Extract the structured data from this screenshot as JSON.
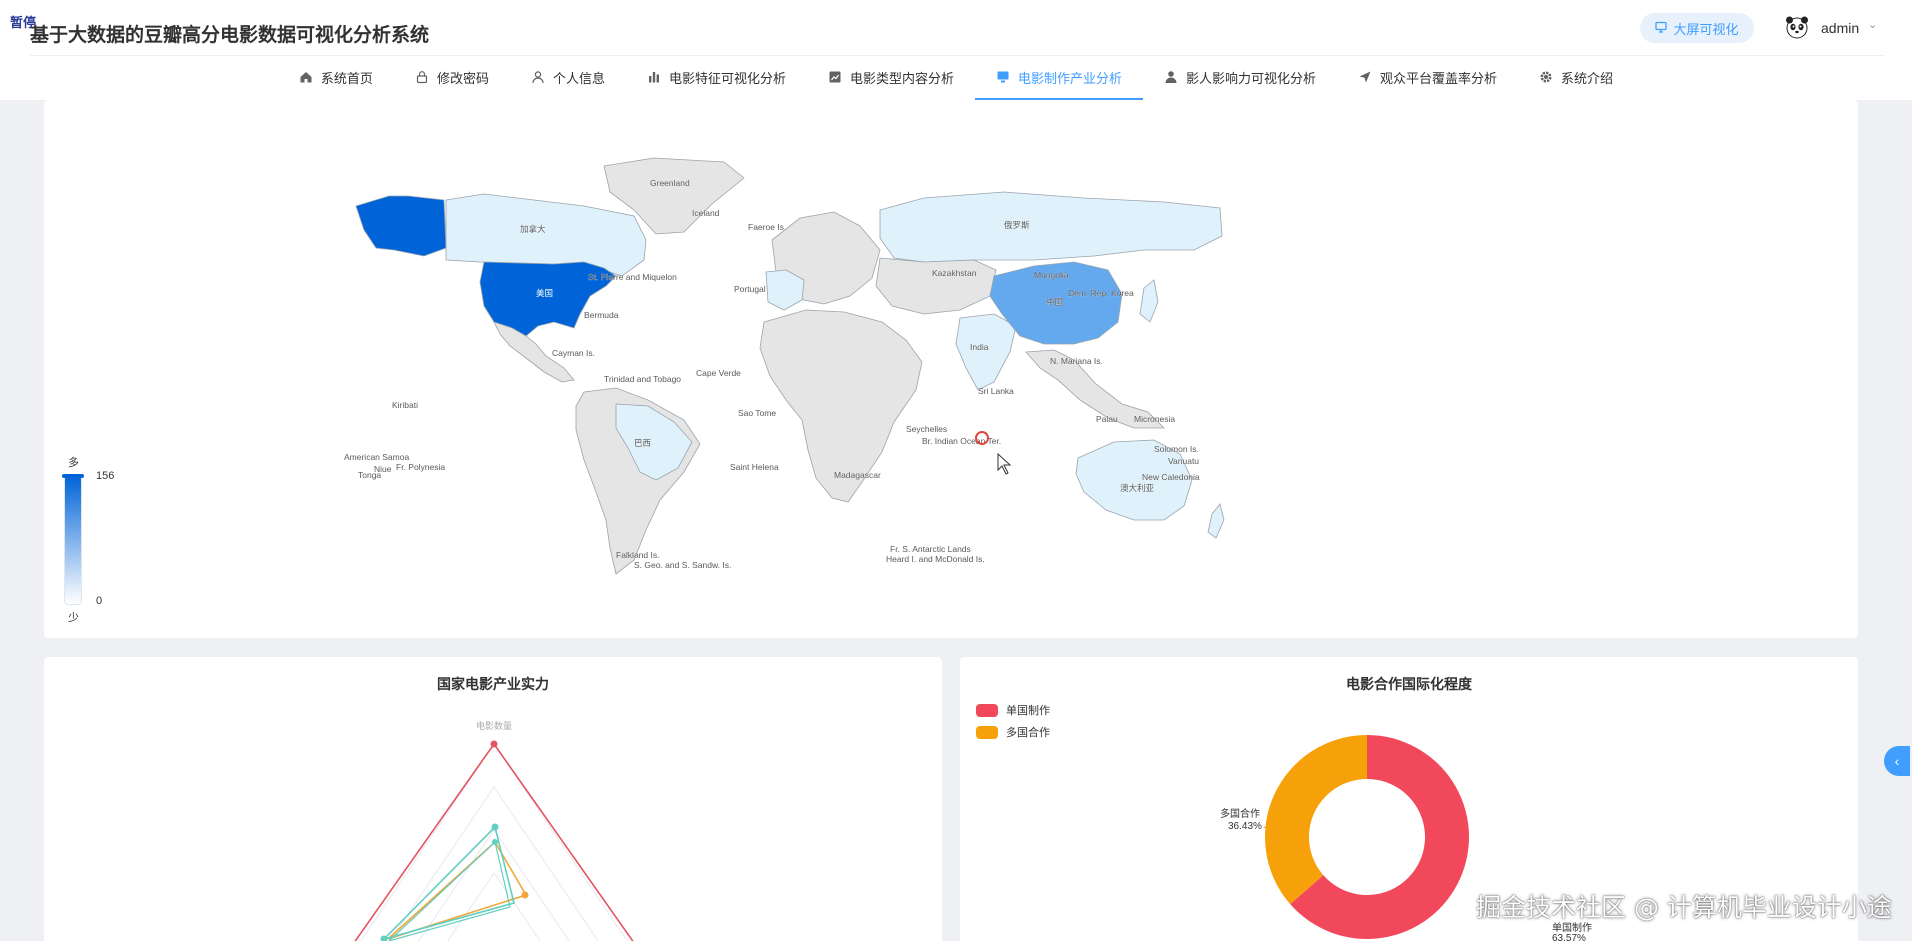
{
  "header": {
    "corner_tag": "暂停",
    "title": "基于大数据的豆瓣高分电影数据可视化分析系统",
    "bigscreen_label": "大屏可视化",
    "username": "admin"
  },
  "nav": {
    "items": [
      {
        "label": "系统首页",
        "icon": "home-icon"
      },
      {
        "label": "修改密码",
        "icon": "lock-icon"
      },
      {
        "label": "个人信息",
        "icon": "user-icon"
      },
      {
        "label": "电影特征可视化分析",
        "icon": "bar-chart-icon"
      },
      {
        "label": "电影类型内容分析",
        "icon": "chart-icon"
      },
      {
        "label": "电影制作产业分析",
        "icon": "monitor-icon",
        "active": true
      },
      {
        "label": "影人影响力可视化分析",
        "icon": "person-icon"
      },
      {
        "label": "观众平台覆盖率分析",
        "icon": "send-icon"
      },
      {
        "label": "系统介绍",
        "icon": "gear-icon"
      }
    ]
  },
  "map_card": {
    "visual_map": {
      "high_label": "多",
      "low_label": "少",
      "max": "156",
      "min": "0"
    },
    "region_labels": {
      "greenland": "Greenland",
      "usa": "美国",
      "china": "中国",
      "brazil": "巴西",
      "australia": "澳大利亚",
      "russia": "俄罗斯",
      "canada": "加拿大",
      "bermuda": "Bermuda",
      "kiribati": "Kiribati",
      "micronesia": "Micronesia",
      "palau": "Palau",
      "seychelles": "Seychelles",
      "saint_helena": "Saint Helena",
      "br_indian_ocean": "Br. Indian Ocean Ter.",
      "fr_polynesia": "Fr. Polynesia",
      "tonga": "Tonga",
      "niue": "Niue",
      "american_samoa": "American Samoa",
      "new_caledonia": "New Caledonia",
      "vanuatu": "Vanuatu",
      "solomon": "Solomon Is.",
      "falkland": "Falkland Is.",
      "s_geo": "S. Geo. and S. Sandw. Is.",
      "fr_antarctic": "Fr. S. Antarctic Lands",
      "heard": "Heard I. and McDonald Is.",
      "n_mariana": "N. Mariana Is.",
      "st_pierre": "St. Pierre and Miquelon",
      "cape_verde": "Cape Verde",
      "sao_tome": "Sao Tome",
      "iceland": "Iceland",
      "faeroe": "Faeroe Is.",
      "kazakhstan": "Kazakhstan",
      "mongolia": "Mongolia",
      "dem_rep_korea": "Dem. Rep. Korea",
      "india": "India",
      "sri_lanka": "Sri Lanka",
      "cayman": "Cayman Is.",
      "trinidad": "Trinidad and Tobago",
      "portugal": "Portugal",
      "madagascar": "Madagascar"
    }
  },
  "radar_card": {
    "title": "国家电影产业实力",
    "indicator_top": "电影数量"
  },
  "donut_card": {
    "title": "电影合作国际化程度",
    "legend": [
      {
        "name": "单国制作",
        "color": "#f1495b"
      },
      {
        "name": "多国合作",
        "color": "#f7a10a"
      }
    ],
    "slices": [
      {
        "name": "单国制作",
        "value": 63.57,
        "label": "单国制作",
        "pct": "63.57%"
      },
      {
        "name": "多国合作",
        "value": 36.43,
        "label": "多国合作",
        "pct": "36.43%"
      }
    ]
  },
  "watermark": "掘金技术社区 @ 计算机毕业设计小途",
  "colors": {
    "accent": "#409eff",
    "map_high": "#0064d8",
    "map_mid": "#64a8ee",
    "map_low": "#dff2fc",
    "map_none": "#e5e5e5",
    "radar_red": "#e3545f",
    "radar_teal": "#62cfc1",
    "radar_orange": "#f1a63a"
  }
}
